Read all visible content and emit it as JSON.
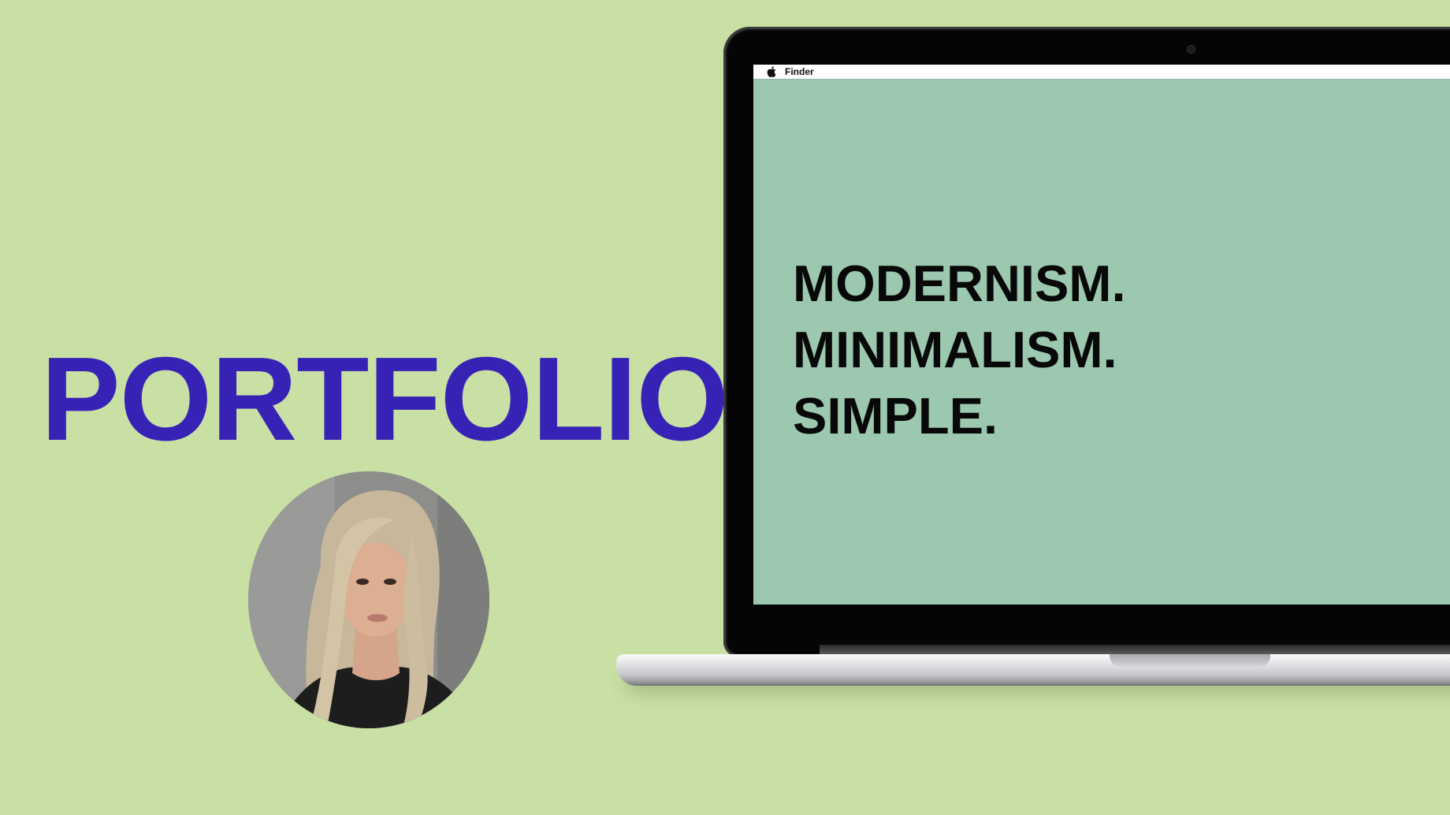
{
  "page": {
    "title": "PORTFOLIO",
    "avatar_alt": "portrait photo"
  },
  "screen": {
    "menubar": {
      "app_name": "Finder",
      "apple_icon": "apple-logo-icon"
    },
    "headline_lines": [
      "MODERNISM.",
      "MINIMALISM.",
      "SIMPLE."
    ]
  },
  "colors": {
    "background": "#c8e0a4",
    "title": "#3722b6",
    "screen_background": "#9bc8ae",
    "screen_text": "#080808"
  }
}
